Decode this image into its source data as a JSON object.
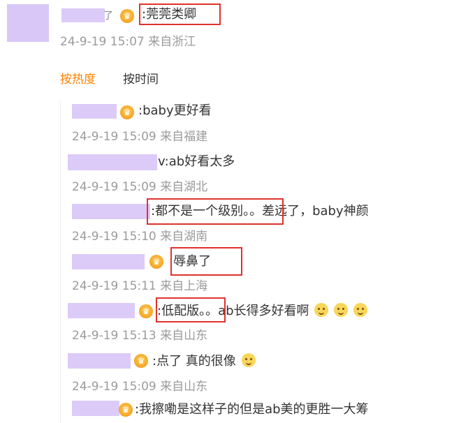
{
  "main_post": {
    "username_suffix": "了",
    "text": ":莞莞类卿",
    "meta": "24-9-19 15:07 来自浙江"
  },
  "sort_tabs": {
    "hot": "按热度",
    "time": "按时间",
    "active_color": "#ff8200"
  },
  "replies": [
    {
      "text": ":baby更好看",
      "meta": "24-9-19 15:09 来自福建"
    },
    {
      "text": "v:ab好看太多",
      "meta": "24-9-19 15:09 来自湖北"
    },
    {
      "text": ":都不是一个级别。。差远了，baby神颜",
      "meta": "24-9-19 15:10 来自湖南"
    },
    {
      "text": ":辱鼻了",
      "meta": "24-9-19 15:11 来自上海"
    },
    {
      "text": ":低配版。。ab长得多好看啊",
      "meta": "24-9-19 15:13 来自山东"
    },
    {
      "text": ":点了 真的很像",
      "meta": "24-9-19 15:09 来自山东"
    },
    {
      "text": ":我擦嘞是这样子的但是ab美的更胜一大筹"
    }
  ],
  "colors": {
    "highlight_box": "#e0322c",
    "avatar_placeholder": "#d9c7f7",
    "meta_text": "#9b9b9b"
  },
  "icons": [
    "crown-badge-icon",
    "smile-emoji-icon",
    "laughing-emoji-icon"
  ]
}
